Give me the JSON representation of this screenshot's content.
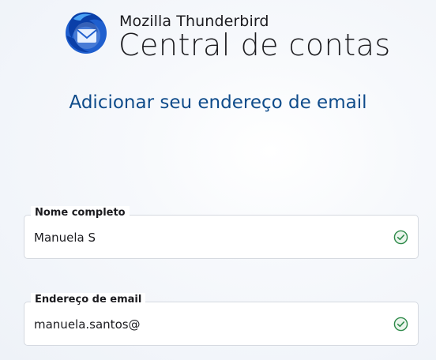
{
  "header": {
    "brand": "Mozilla Thunderbird",
    "title": "Central de contas",
    "logo_icon": "thunderbird-logo"
  },
  "subtitle": "Adicionar seu endereço de email",
  "form": {
    "name_field": {
      "label": "Nome completo",
      "value": "Manuela S",
      "status_icon": "check-circle-icon"
    },
    "email_field": {
      "label": "Endereço de email",
      "value": "manuela.santos@",
      "status_icon": "check-circle-icon"
    }
  },
  "colors": {
    "accent": "#0e4b8a",
    "valid": "#2f8a4a",
    "logo_blue": "#1f5fce"
  }
}
